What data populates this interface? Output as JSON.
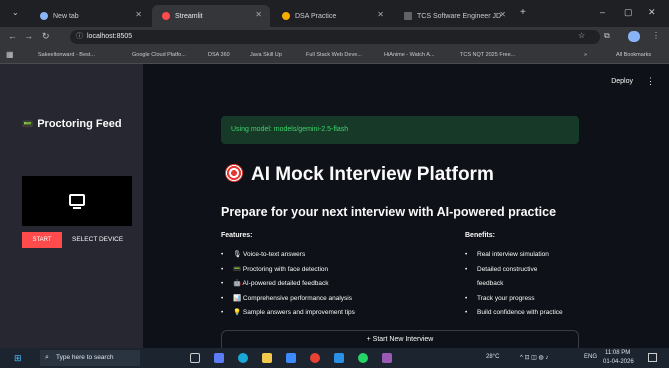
{
  "browser": {
    "tabs": [
      {
        "label": "New tab",
        "fav_color": "#8ab4f8"
      },
      {
        "label": "Streamlit",
        "fav_color": "#ff4b4b"
      },
      {
        "label": "DSA Practice",
        "fav_color": "#f9ab00"
      },
      {
        "label": "TCS Software Engineer JD",
        "fav_color": "#5f6368"
      }
    ],
    "url": "localhost:8505",
    "bookmarks": [
      "Sakeeltonward - Best...",
      "Google Cloud Platfo...",
      "DSA 360",
      "Java Skill Up",
      "Full Stack Web Deve...",
      "HiAnime - Watch A...",
      "TCS NQT 2025 Free..."
    ],
    "all_bookmarks": "All Bookmarks"
  },
  "header": {
    "deploy_label": "Deploy",
    "menu_glyph": "⋮"
  },
  "sidebar": {
    "title_icon": "📟",
    "title": "Proctoring Feed",
    "start_label": "START",
    "select_device_label": "SELECT DEVICE"
  },
  "main": {
    "model_notice": "Using model: models/gemini-2.5-flash",
    "title": "AI Mock Interview Platform",
    "subtitle": "Prepare for your next interview with AI-powered practice",
    "features_heading": "Features:",
    "features": [
      "🎙 Voice-to-text answers",
      "📟 Proctoring with face detection",
      "🤖 AI-powered detailed feedback",
      "📊 Comprehensive performance analysis",
      "💡 Sample answers and improvement tips"
    ],
    "benefits_heading": "Benefits:",
    "benefits": [
      "Real interview simulation",
      "Detailed constructive",
      "feedback",
      "Track your progress",
      "Build confidence with practice"
    ],
    "start_button": "+ Start New Interview"
  },
  "taskbar": {
    "search_placeholder": "Type here to search",
    "weather": "28°C",
    "lang": "ENG",
    "time": "11:08 PM",
    "date": "01-04-2026"
  },
  "colors": {
    "accent": "#ff4b4b",
    "success_bg": "#173928",
    "success_text": "#3dd56d",
    "sidebar_bg": "#262730",
    "main_bg": "#0e1117"
  }
}
